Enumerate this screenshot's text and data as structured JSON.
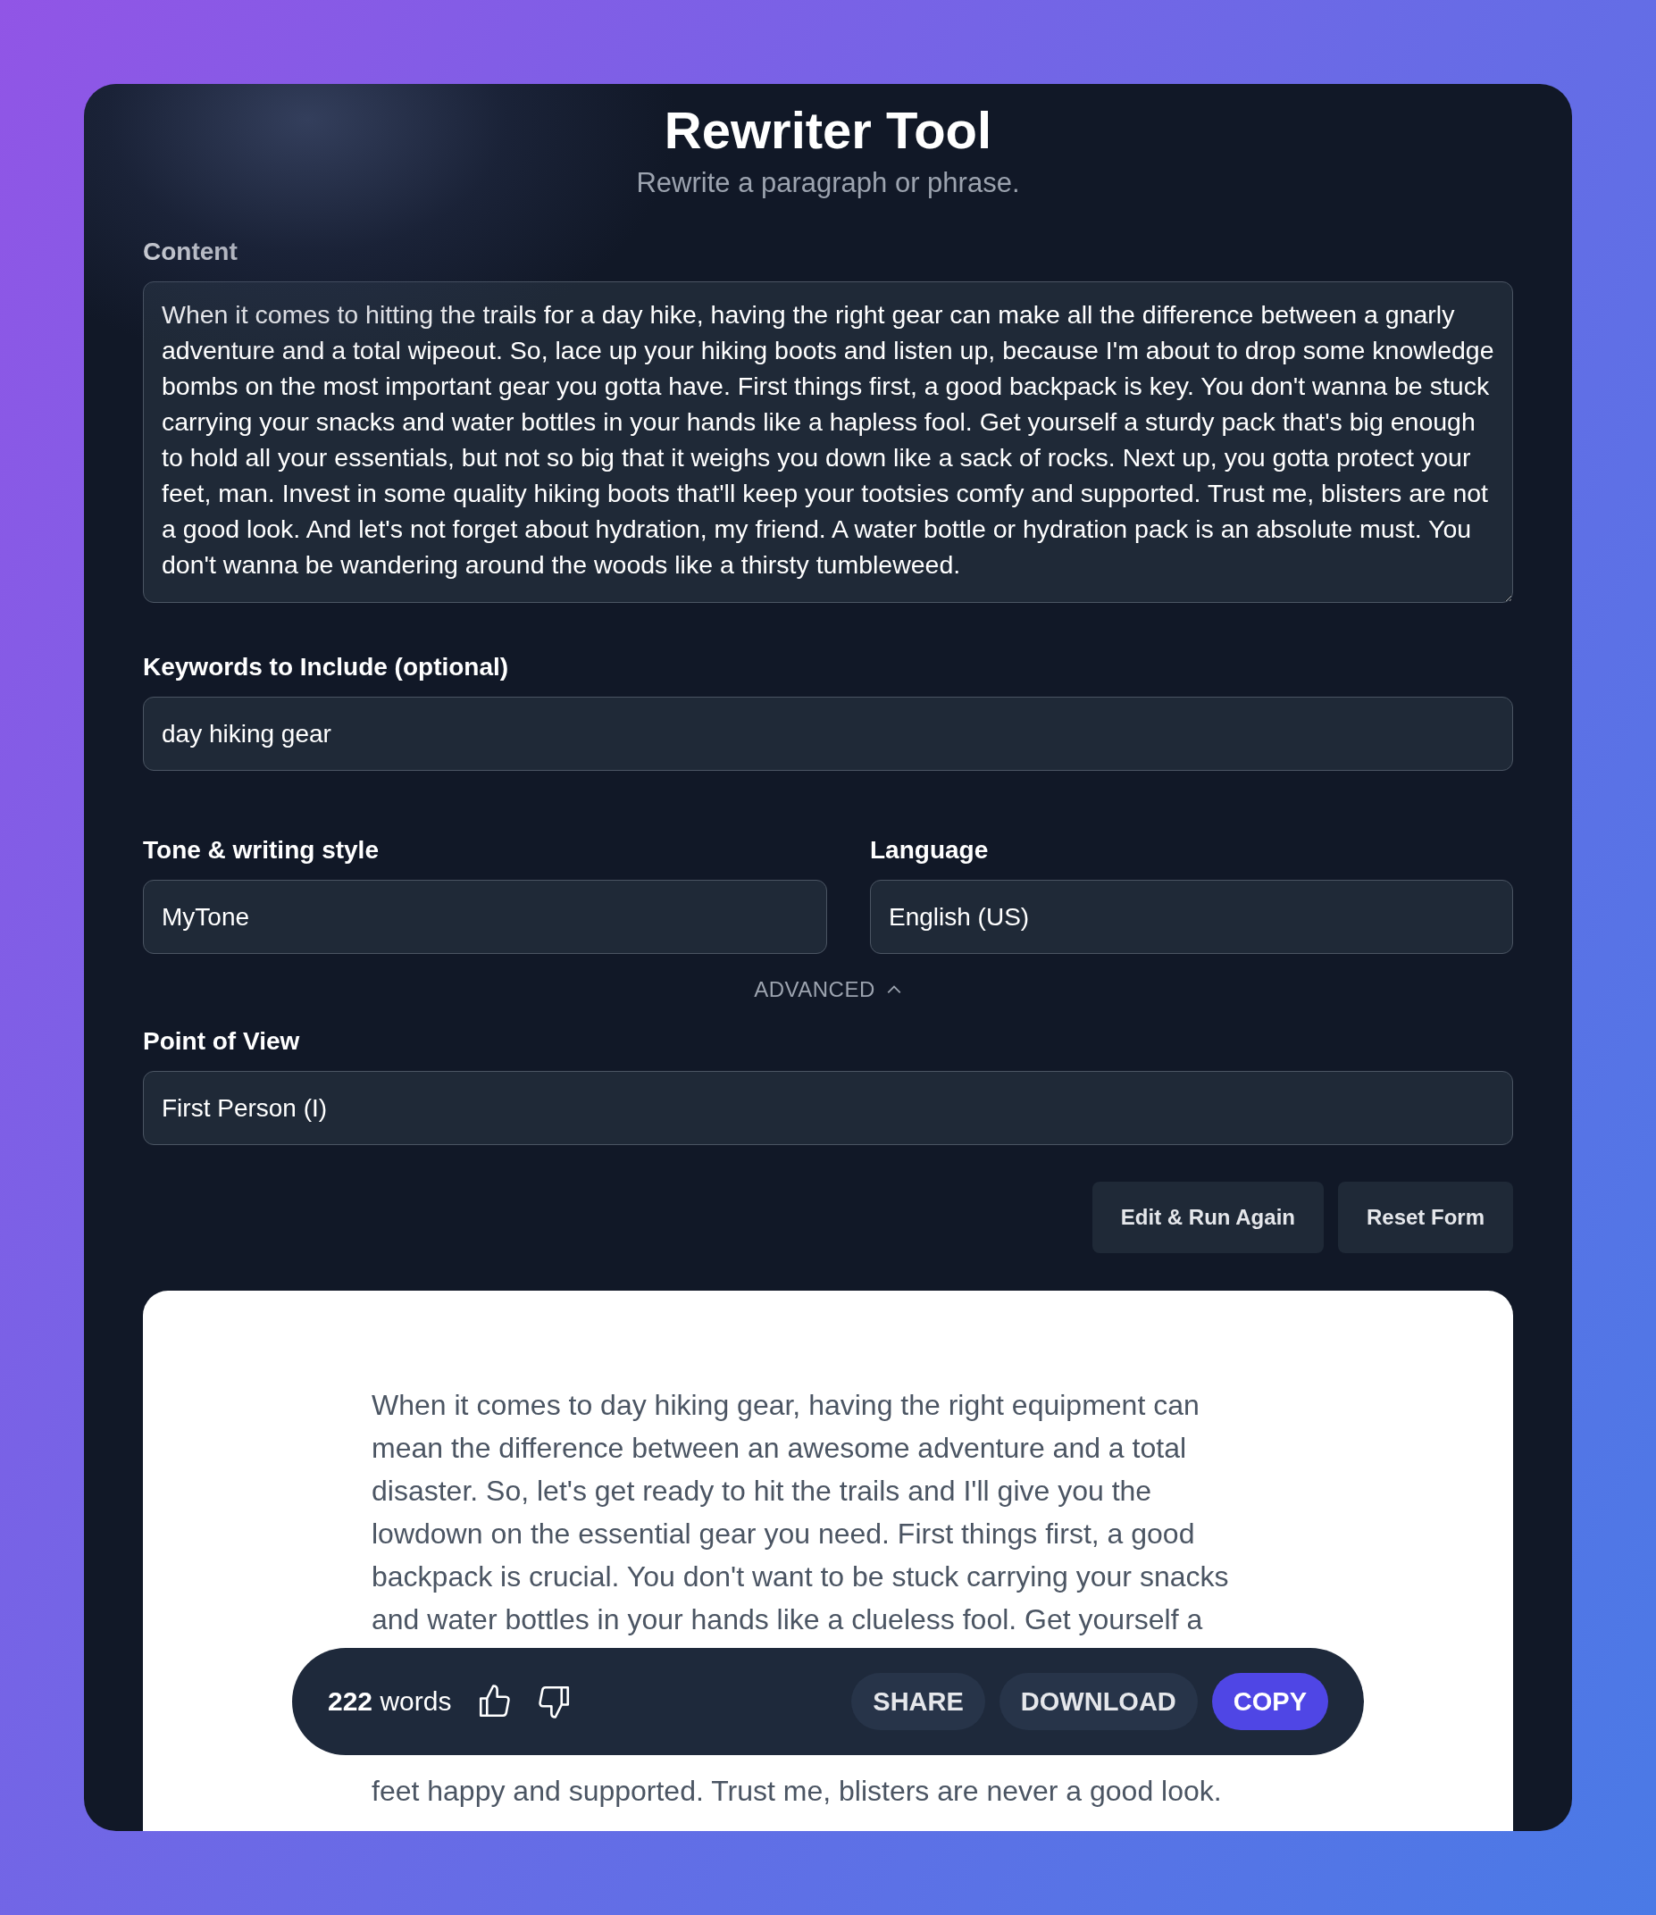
{
  "header": {
    "title": "Rewriter Tool",
    "subtitle": "Rewrite a paragraph or phrase."
  },
  "content": {
    "label": "Content",
    "value": "When it comes to hitting the trails for a day hike, having the right gear can make all the difference between a gnarly adventure and a total wipeout. So, lace up your hiking boots and listen up, because I'm about to drop some knowledge bombs on the most important gear you gotta have. First things first, a good backpack is key. You don't wanna be stuck carrying your snacks and water bottles in your hands like a hapless fool. Get yourself a sturdy pack that's big enough to hold all your essentials, but not so big that it weighs you down like a sack of rocks. Next up, you gotta protect your feet, man. Invest in some quality hiking boots that'll keep your tootsies comfy and supported. Trust me, blisters are not a good look. And let's not forget about hydration, my friend. A water bottle or hydration pack is an absolute must. You don't wanna be wandering around the woods like a thirsty tumbleweed."
  },
  "keywords": {
    "label": "Keywords to Include (optional)",
    "value": "day hiking gear"
  },
  "tone": {
    "label": "Tone & writing style",
    "value": "MyTone"
  },
  "language": {
    "label": "Language",
    "value": "English (US)"
  },
  "advanced": {
    "label": "ADVANCED",
    "expanded": true
  },
  "point_of_view": {
    "label": "Point of View",
    "value": "First Person (I)"
  },
  "buttons": [
    "Edit & Run Again",
    "Reset Form"
  ],
  "output": {
    "text_before": "When it comes to day hiking gear, having the right equipment can mean the difference between an awesome adventure and a total disaster. So, let's get ready to hit the trails and I'll give you the lowdown on the essential gear you need. First things first, a good backpack is crucial. You don't want to be stuck carrying your snacks and water bottles in your hands like a clueless fool. Get yourself a",
    "text_after": "feet happy and supported. Trust me, blisters are never a good look."
  },
  "toolbar": {
    "count": "222",
    "count_unit": "words",
    "actions": [
      {
        "label": "SHARE",
        "primary": false
      },
      {
        "label": "DOWNLOAD",
        "primary": false
      },
      {
        "label": "COPY",
        "primary": true
      }
    ]
  }
}
